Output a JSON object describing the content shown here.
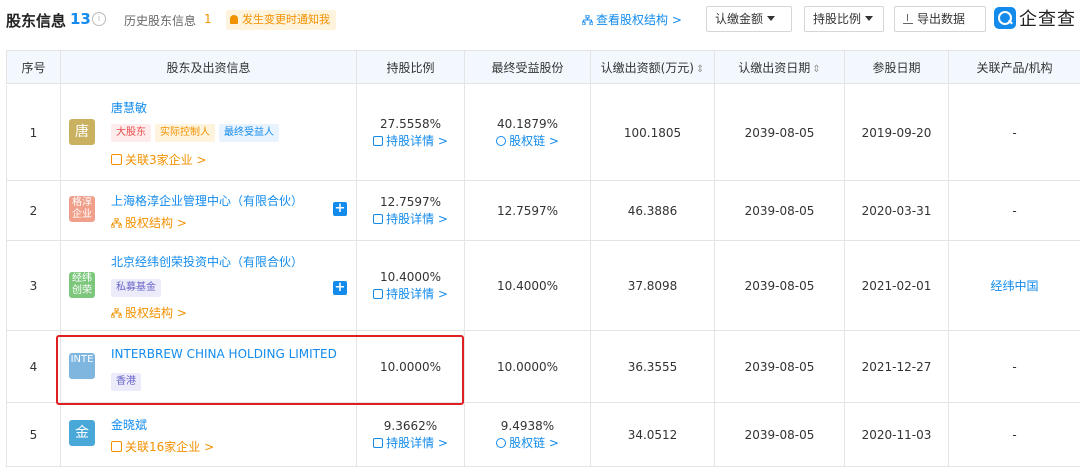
{
  "header": {
    "title": "股东信息",
    "count": "13",
    "info_icon": "info-icon",
    "history_label": "历史股东信息",
    "history_count": "1",
    "notify_label": "发生变更时通知我",
    "structure_link": "查看股权结构 >",
    "amount_dropdown": "认缴金额",
    "ratio_dropdown": "持股比例",
    "export_label": "导出数据",
    "logo_text": "企查查"
  },
  "table": {
    "columns": [
      "序号",
      "股东及出资信息",
      "持股比例",
      "最终受益股份",
      "认缴出资额(万元)",
      "认缴出资日期",
      "参股日期",
      "关联产品/机构"
    ],
    "sortable_columns": [
      "认缴出资额(万元)",
      "认缴出资日期"
    ],
    "rows": [
      {
        "index": "1",
        "avatar_text": "唐",
        "avatar_color": "#c9b15f",
        "name": "唐慧敏",
        "tags": [
          "大股东",
          "实际控制人",
          "最终受益人"
        ],
        "related": "关联3家企业 >",
        "ratio": "27.5558%",
        "ratio_link": "持股详情 >",
        "benefit": "40.1879%",
        "benefit_link": "股权链 >",
        "amount": "100.1805",
        "sub_date": "2039-08-05",
        "join_date": "2019-09-20",
        "product": "-"
      },
      {
        "index": "2",
        "avatar_text": "格淳企业",
        "avatar_color": "#f0a08a",
        "name": "上海格淳企业管理中心（有限合伙）",
        "structure": "股权结构 >",
        "ratio": "12.7597%",
        "ratio_link": "持股详情 >",
        "benefit": "12.7597%",
        "amount": "46.3886",
        "sub_date": "2039-08-05",
        "join_date": "2020-03-31",
        "product": "-"
      },
      {
        "index": "3",
        "avatar_text": "经纬创荣",
        "avatar_color": "#7dc77d",
        "name": "北京经纬创荣投资中心（有限合伙）",
        "tags": [
          "私募基金"
        ],
        "structure": "股权结构 >",
        "ratio": "10.4000%",
        "ratio_link": "持股详情 >",
        "benefit": "10.4000%",
        "amount": "37.8098",
        "sub_date": "2039-08-05",
        "join_date": "2021-02-01",
        "product": "经纬中国"
      },
      {
        "index": "4",
        "avatar_text": "INTE",
        "avatar_color": "#7eb6e0",
        "name": "INTERBREW CHINA HOLDING LIMITED",
        "tags": [
          "香港"
        ],
        "ratio": "10.0000%",
        "benefit": "10.0000%",
        "amount": "36.3555",
        "sub_date": "2039-08-05",
        "join_date": "2021-12-27",
        "product": "-"
      },
      {
        "index": "5",
        "avatar_text": "金",
        "avatar_color": "#4aa8d8",
        "name": "金晓斌",
        "related": "关联16家企业 >",
        "ratio": "9.3662%",
        "ratio_link": "持股详情 >",
        "benefit": "9.4938%",
        "benefit_link": "股权链 >",
        "amount": "34.0512",
        "sub_date": "2039-08-05",
        "join_date": "2020-11-03",
        "product": "-"
      }
    ]
  },
  "colors": {
    "accent": "#128bed",
    "orange": "#f29100",
    "highlight": "#e02020"
  }
}
